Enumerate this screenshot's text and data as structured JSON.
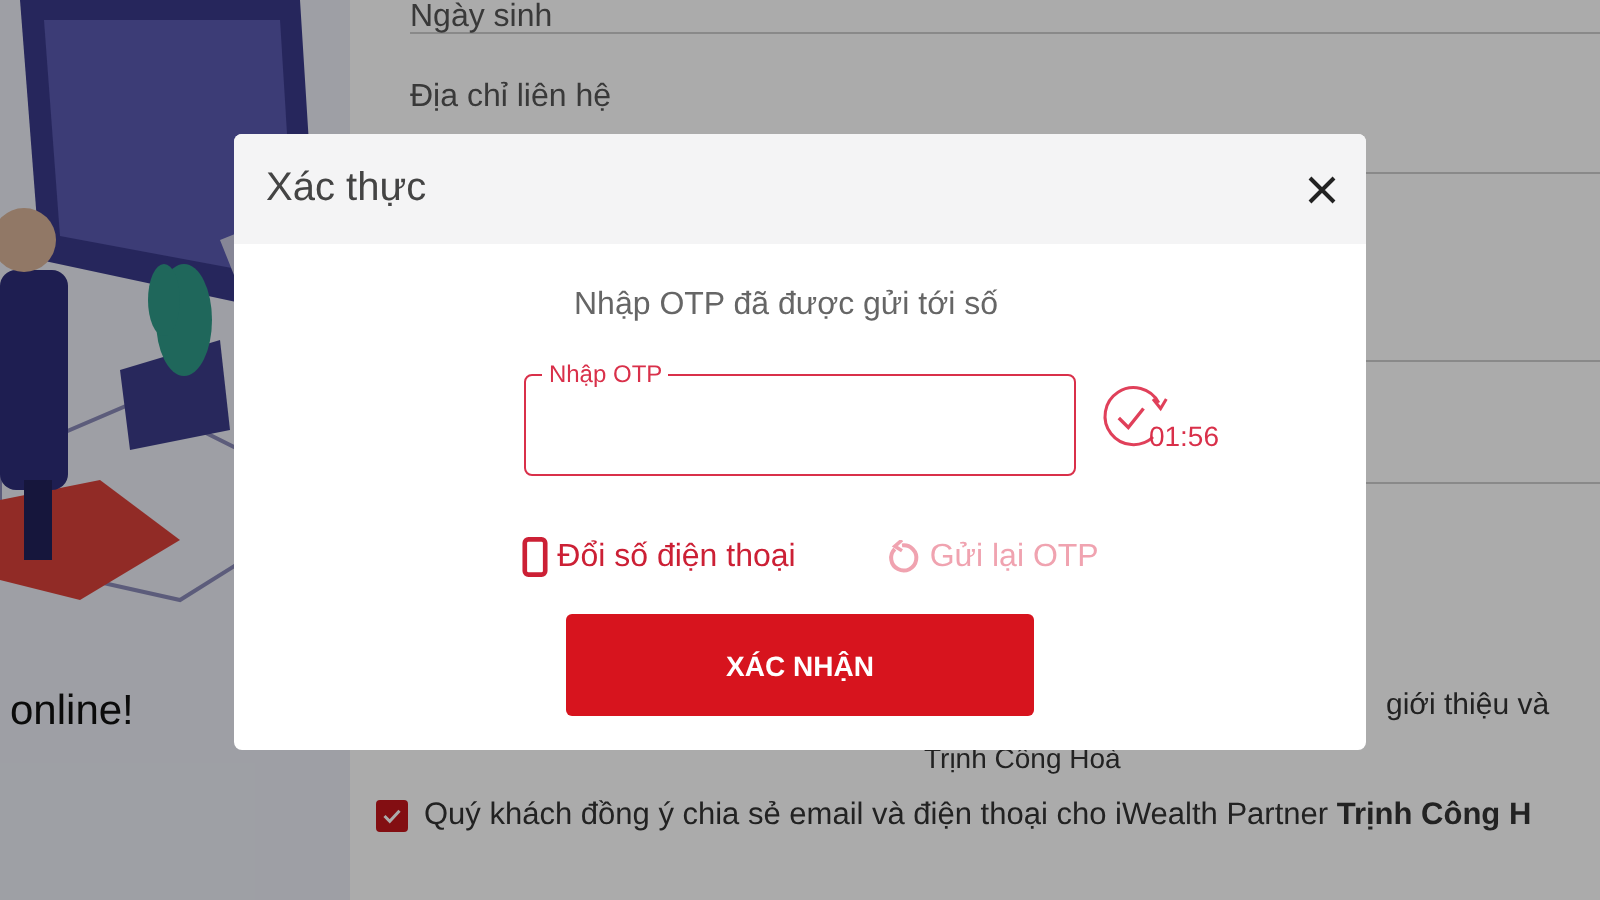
{
  "background": {
    "fields": [
      {
        "label": "Ngày sinh"
      },
      {
        "label": "Địa chỉ liên hệ"
      }
    ],
    "tagline": "online!",
    "intro_fragment": "giới thiệu và",
    "partner_name": "Trịnh Công Hoà",
    "consents": [
      {
        "text": "Quý khách đồng ý chia sẻ email và điện thoại cho iWealth Partner **Trịnh Công H**",
        "checked": true
      }
    ]
  },
  "dialog": {
    "title": "Xác thực",
    "instruction": "Nhập OTP đã được gửi tới số",
    "otp_field": {
      "label": "Nhập OTP"
    },
    "countdown": "01:56",
    "actions": [
      {
        "kind": "phone",
        "label": "Đổi số điện thoại",
        "disabled": false
      },
      {
        "kind": "resend",
        "label": "Gửi lại OTP",
        "disabled": true
      }
    ],
    "confirm": "XÁC NHẬN"
  }
}
